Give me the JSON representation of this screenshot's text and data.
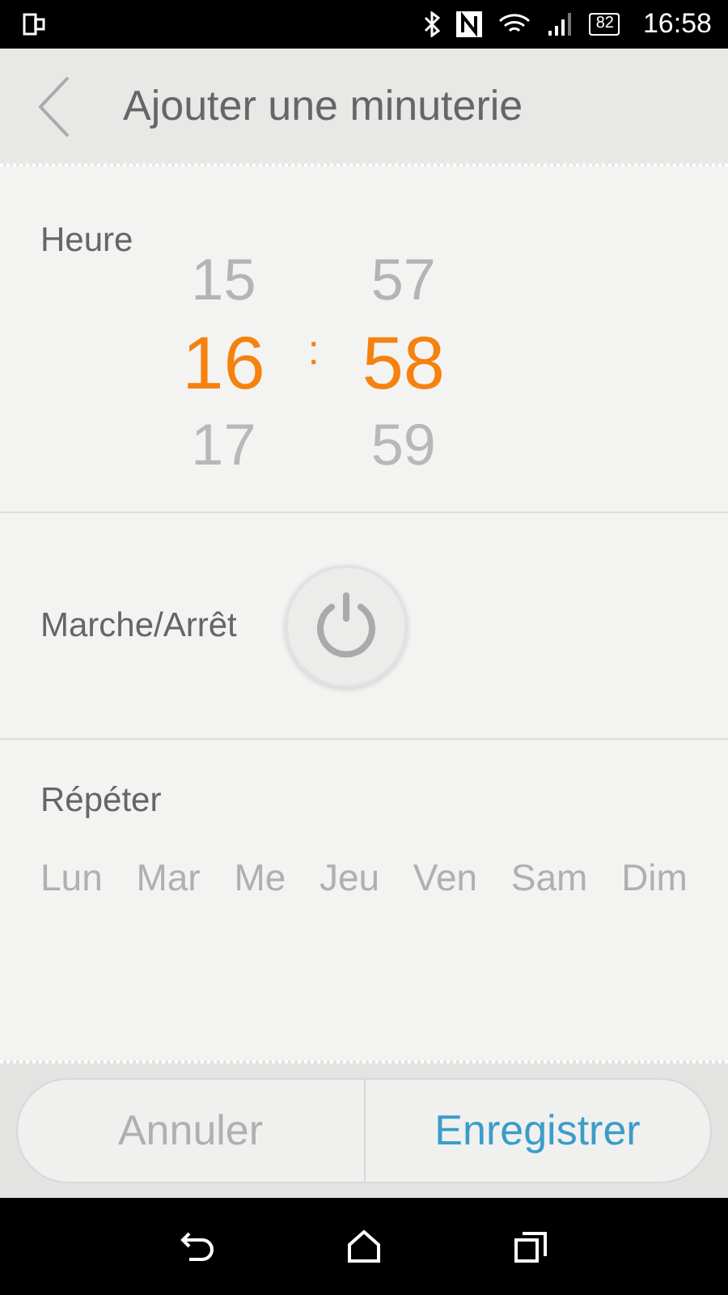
{
  "status_bar": {
    "battery": "82",
    "time": "16:58"
  },
  "header": {
    "title": "Ajouter une minuterie"
  },
  "time_picker": {
    "label": "Heure",
    "separator": ":",
    "hours": [
      {
        "value": "15",
        "selected": false
      },
      {
        "value": "16",
        "selected": true
      },
      {
        "value": "17",
        "selected": false
      }
    ],
    "minutes": [
      {
        "value": "57",
        "selected": false
      },
      {
        "value": "58",
        "selected": true
      },
      {
        "value": "59",
        "selected": false
      }
    ]
  },
  "power": {
    "label": "Marche/Arrêt",
    "on": false
  },
  "repeat": {
    "label": "Répéter",
    "days": [
      {
        "label": "Lun",
        "selected": false
      },
      {
        "label": "Mar",
        "selected": false
      },
      {
        "label": "Me",
        "selected": false
      },
      {
        "label": "Jeu",
        "selected": false
      },
      {
        "label": "Ven",
        "selected": false
      },
      {
        "label": "Sam",
        "selected": false
      },
      {
        "label": "Dim",
        "selected": false
      }
    ]
  },
  "buttons": [
    {
      "label": "Annuler",
      "kind": "cancel"
    },
    {
      "label": "Enregistrer",
      "kind": "save"
    }
  ]
}
